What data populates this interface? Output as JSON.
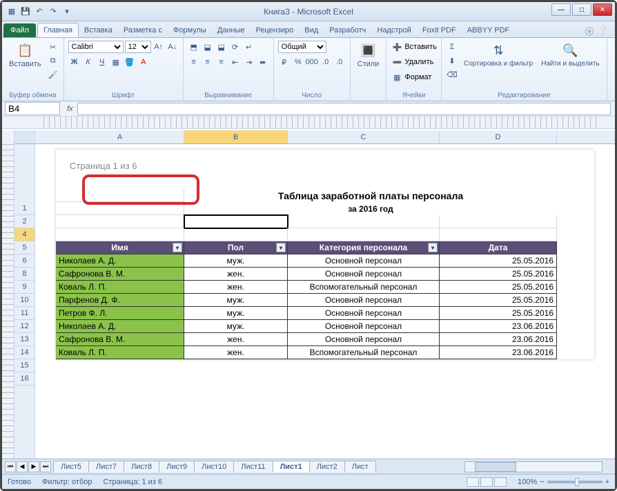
{
  "window": {
    "title": "Книга3 - Microsoft Excel"
  },
  "tabs": {
    "file": "Файл",
    "items": [
      "Главная",
      "Вставка",
      "Разметка с",
      "Формулы",
      "Данные",
      "Рецензиро",
      "Вид",
      "Разработч",
      "Надстрой",
      "Foxit PDF",
      "ABBYY PDF"
    ],
    "active": 0
  },
  "ribbon": {
    "clipboard": {
      "paste": "Вставить",
      "label": "Буфер обмена"
    },
    "font": {
      "name": "Calibri",
      "size": "12",
      "label": "Шрифт"
    },
    "align": {
      "label": "Выравнивание"
    },
    "number": {
      "format": "Общий",
      "label": "Число"
    },
    "styles": {
      "btn": "Стили",
      "label": ""
    },
    "cells": {
      "insert": "Вставить",
      "delete": "Удалить",
      "format": "Формат",
      "label": "Ячейки"
    },
    "editing": {
      "sort": "Сортировка и фильтр",
      "find": "Найти и выделить",
      "label": "Редактирование"
    }
  },
  "fx": {
    "name": "B4",
    "formula": ""
  },
  "header_text": "Страница 1 из 6",
  "table": {
    "title": "Таблица заработной платы персонала",
    "subtitle": "за 2016 год",
    "columns": [
      "Имя",
      "Пол",
      "Категория персонала",
      "Дата"
    ],
    "rows": [
      {
        "n": "Николаев А. Д.",
        "g": "муж.",
        "c": "Основной персонал",
        "d": "25.05.2016"
      },
      {
        "n": "Сафронова В. М.",
        "g": "жен.",
        "c": "Основной персонал",
        "d": "25.05.2016"
      },
      {
        "n": "Коваль Л. П.",
        "g": "жен.",
        "c": "Вспомогательный персонал",
        "d": "25.05.2016"
      },
      {
        "n": "Парфенов Д. Ф.",
        "g": "муж.",
        "c": "Основной персонал",
        "d": "25.05.2016"
      },
      {
        "n": "Петров Ф. Л.",
        "g": "муж.",
        "c": "Основной персонал",
        "d": "25.05.2016"
      },
      {
        "n": "Николаев А. Д.",
        "g": "муж.",
        "c": "Основной персонал",
        "d": "23.06.2016"
      },
      {
        "n": "Сафронова В. М.",
        "g": "жен.",
        "c": "Основной персонал",
        "d": "23.06.2016"
      },
      {
        "n": "Коваль Л. П.",
        "g": "жен.",
        "c": "Вспомогательный персонал",
        "d": "23.06.2016"
      }
    ]
  },
  "row_numbers": [
    "1",
    "2",
    "4",
    "5",
    "6",
    "8",
    "9",
    "10",
    "11",
    "12",
    "13",
    "14",
    "15",
    "16"
  ],
  "col_letters": [
    "A",
    "B",
    "C",
    "D"
  ],
  "sheets": {
    "items": [
      "Лист5",
      "Лист7",
      "Лист8",
      "Лист9",
      "Лист10",
      "Лист11",
      "Лист1",
      "Лист2",
      "Лист"
    ],
    "active": 6
  },
  "status": {
    "ready": "Готово",
    "filter": "Фильтр: отбор",
    "page": "Страница: 1 из 6",
    "zoom": "100%"
  }
}
